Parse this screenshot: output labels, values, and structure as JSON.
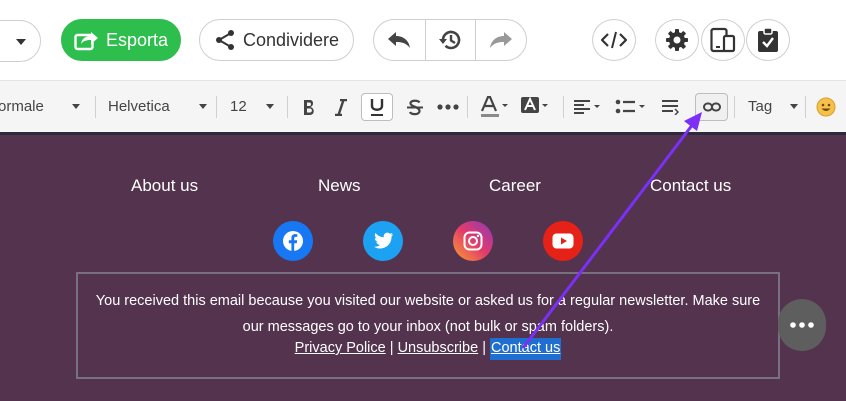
{
  "topbar": {
    "export_label": "Esporta",
    "share_label": "Condividere",
    "history_icons": [
      "undo-icon",
      "history-icon",
      "redo-icon"
    ],
    "right_icons": [
      "code-icon",
      "gear-icon",
      "device-preview-icon",
      "clipboard-check-icon"
    ]
  },
  "toolbar": {
    "paragraph_style": "ormale",
    "font_family": "Helvetica",
    "font_size": "12",
    "tag_label": "Tag",
    "buttons": [
      "bold",
      "italic",
      "underline",
      "strikethrough",
      "more",
      "text-color",
      "background-color",
      "align",
      "list",
      "line-height",
      "link",
      "emoji"
    ],
    "active_buttons": [
      "underline",
      "link"
    ]
  },
  "footer": {
    "nav": [
      "About us",
      "News",
      "Career",
      "Contact us"
    ],
    "social": [
      "facebook-icon",
      "twitter-icon",
      "instagram-icon",
      "youtube-icon"
    ],
    "notice_line1": "You received this email because you visited our website or asked us for a regular newsletter. Make sure",
    "notice_line2": "our messages go to your inbox (not bulk or spam folders).",
    "link_privacy": "Privacy Police",
    "link_unsubscribe": "Unsubscribe",
    "link_contact": "Contact us",
    "separator": "|"
  },
  "colors": {
    "export_green": "#2dbe4e",
    "footer_bg": "#53334d",
    "selection_blue": "#1f6fd1",
    "arrow_purple": "#7b2ff7",
    "facebook": "#1877f2",
    "twitter": "#1da1f2",
    "youtube": "#e62117"
  }
}
